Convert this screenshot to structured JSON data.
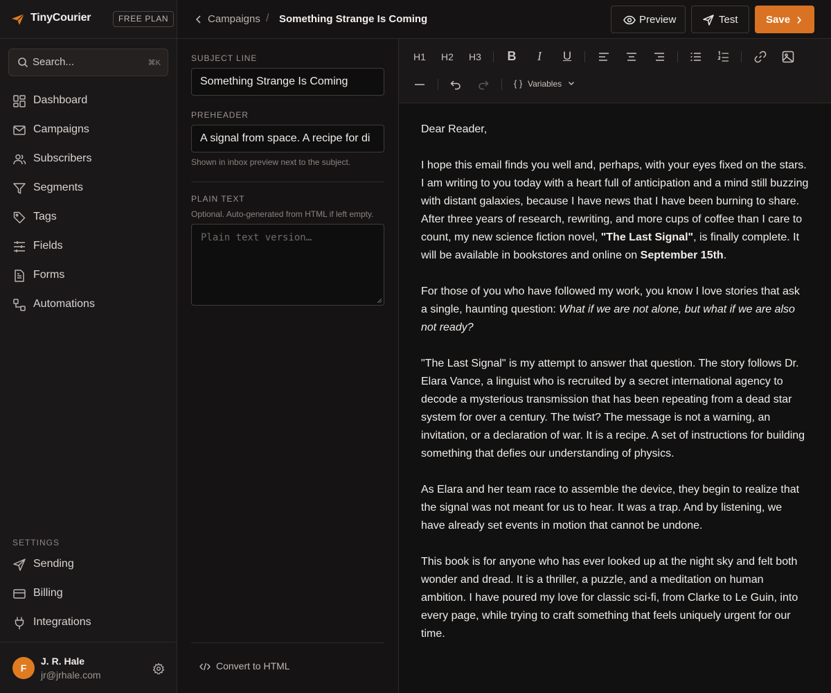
{
  "brand": {
    "name": "TinyCourier",
    "plan": "FREE PLAN",
    "accent": "#d97222"
  },
  "search": {
    "placeholder": "Search...",
    "shortcut": "⌘K"
  },
  "nav": {
    "items": [
      {
        "label": "Dashboard",
        "icon": "grid-icon"
      },
      {
        "label": "Campaigns",
        "icon": "mail-icon"
      },
      {
        "label": "Subscribers",
        "icon": "users-icon"
      },
      {
        "label": "Segments",
        "icon": "filter-icon"
      },
      {
        "label": "Tags",
        "icon": "tag-icon"
      },
      {
        "label": "Fields",
        "icon": "sliders-icon"
      },
      {
        "label": "Forms",
        "icon": "document-icon"
      },
      {
        "label": "Automations",
        "icon": "workflow-icon"
      }
    ],
    "settings_label": "SETTINGS",
    "settings_items": [
      {
        "label": "Sending",
        "icon": "send-icon"
      },
      {
        "label": "Billing",
        "icon": "credit-card-icon"
      },
      {
        "label": "Integrations",
        "icon": "plug-icon"
      }
    ]
  },
  "user": {
    "initial": "F",
    "name": "J. R. Hale",
    "email": "jr@jrhale.com"
  },
  "breadcrumb": {
    "parent": "Campaigns",
    "separator": "/",
    "current": "Something Strange Is Coming"
  },
  "actions": {
    "preview": "Preview",
    "test": "Test",
    "save": "Save"
  },
  "campaign": {
    "subject_label": "SUBJECT LINE",
    "subject_value": "Something Strange Is Coming",
    "preheader_label": "PREHEADER",
    "preheader_value": "A signal from space. A recipe for di",
    "preheader_hint": "Shown in inbox preview next to the subject.",
    "plain_label": "PLAIN TEXT",
    "plain_hint": "Optional. Auto-generated from HTML if left empty.",
    "plain_placeholder": "Plain text version…",
    "convert_label": "Convert to HTML"
  },
  "toolbar": {
    "h1": "H1",
    "h2": "H2",
    "h3": "H3",
    "bold": "B",
    "italic": "I",
    "underline": "U",
    "variables": "Variables",
    "variables_glyph": "{ }"
  },
  "body": {
    "greeting": "Dear Reader,",
    "p1": "I hope this email finds you well and, perhaps, with your eyes fixed on the stars. I am writing to you today with a heart full of anticipation and a mind still buzzing with distant galaxies, because I have news that I have been burning to share.",
    "p2_a": "After three years of research, rewriting, and more cups of coffee than I care to count, my new science fiction novel, ",
    "p2_title": "\"The Last Signal\"",
    "p2_b": ", is finally complete. It will be available in bookstores and online on ",
    "p2_date": "September 15th",
    "p2_c": ".",
    "p3_a": "For those of you who have followed my work, you know I love stories that ask a single, haunting question: ",
    "p3_quote": "What if we are not alone, but what if we are also not ready?",
    "p4": "\"The Last Signal\" is my attempt to answer that question. The story follows Dr. Elara Vance, a linguist who is recruited by a secret international agency to decode a mysterious transmission that has been repeating from a dead star system for over a century. The twist? The message is not a warning, an invitation, or a declaration of war. It is a recipe. A set of instructions for building something that defies our understanding of physics.",
    "p5": "As Elara and her team race to assemble the device, they begin to realize that the signal was not meant for us to hear. It was a trap. And by listening, we have already set events in motion that cannot be undone.",
    "p6": "This book is for anyone who has ever looked up at the night sky and felt both wonder and dread. It is a thriller, a puzzle, and a meditation on human ambition. I have poured my love for classic sci-fi, from Clarke to Le Guin, into every page, while trying to craft something that feels uniquely urgent for our time."
  }
}
